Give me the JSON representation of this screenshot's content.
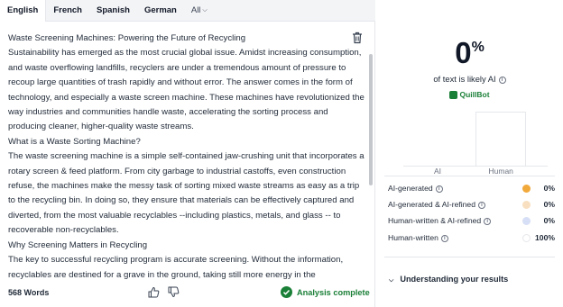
{
  "tabs": [
    {
      "label": "English",
      "active": true
    },
    {
      "label": "French"
    },
    {
      "label": "Spanish"
    },
    {
      "label": "German"
    },
    {
      "label": "All"
    }
  ],
  "editor": {
    "paragraphs": [
      "Waste Screening Machines: Powering the Future of Recycling",
      "Sustainability has emerged as the most crucial global issue. Amidst increasing consumption, and waste overflowing landfills, recyclers are under a tremendous amount of pressure to recoup large quantities of trash rapidly and without error. The answer comes in the form of technology, and especially a waste screen machine. These machines have revolutionized the way industries and communities handle waste, accelerating the sorting process and producing cleaner, higher-quality waste streams.",
      "What is a Waste Sorting Machine?",
      "The waste screening machine is a simple self-contained jaw-crushing unit that incorporates a rotary screen & feed platform. From city garbage to industrial castoffs, even construction refuse, the machines make the messy task of sorting mixed waste streams as easy as a trip to the recycling bin. In doing so, they ensure that materials can be effectively captured and diverted, from the most valuable recyclables --including plastics, metals, and glass -- to recoverable non-recyclables.",
      "Why Screening Matters in Recycling",
      "The key to successful recycling program is accurate screening. Without the information, recyclables are destined for a grave in the ground, taking still more energy in the"
    ],
    "word_count": "568 Words",
    "status": "Analysis complete"
  },
  "result": {
    "score": "0",
    "score_unit": "%",
    "likely_text": "of text is likely AI",
    "brand": "QuillBot"
  },
  "chart_data": {
    "type": "bar",
    "categories": [
      "AI",
      "Human"
    ],
    "values": [
      0,
      100
    ],
    "ylim": [
      0,
      100
    ]
  },
  "legend": [
    {
      "label": "AI-generated",
      "value": "0%",
      "color": "#f2a93b"
    },
    {
      "label": "AI-generated & AI-refined",
      "value": "0%",
      "color": "#f8dfc0"
    },
    {
      "label": "Human-written & AI-refined",
      "value": "0%",
      "color": "#d6dff5"
    },
    {
      "label": "Human-written",
      "value": "100%",
      "color": "#ffffff"
    }
  ],
  "understanding": "Understanding your results"
}
